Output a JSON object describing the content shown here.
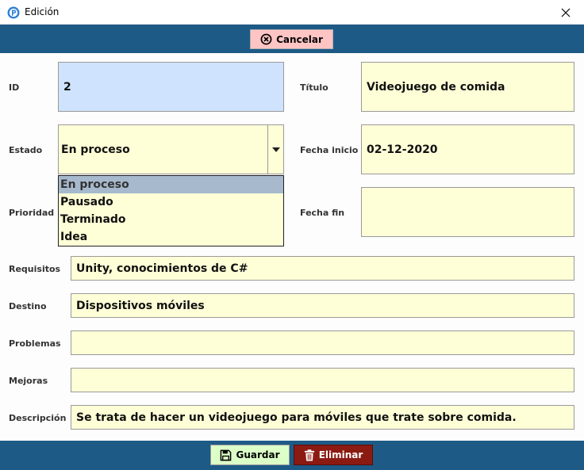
{
  "window": {
    "title": "Edición",
    "app_icon": "p-logo-icon",
    "close_glyph": "✕"
  },
  "toolbar": {
    "cancel_label": "Cancelar",
    "cancel_icon": "circle-x-icon"
  },
  "fields": {
    "id": {
      "label": "ID",
      "value": "2"
    },
    "titulo": {
      "label": "Título",
      "value": "Videojuego de comida"
    },
    "estado": {
      "label": "Estado",
      "value": "En proceso",
      "options": [
        "En proceso",
        "Pausado",
        "Terminado",
        "Idea"
      ],
      "selected_index": 0
    },
    "fecha_inicio": {
      "label": "Fecha inicio",
      "value": "02-12-2020"
    },
    "prioridad": {
      "label": "Prioridad",
      "value": ""
    },
    "fecha_fin": {
      "label": "Fecha fin",
      "value": ""
    },
    "requisitos": {
      "label": "Requisitos",
      "value": "Unity, conocimientos de C#"
    },
    "destino": {
      "label": "Destino",
      "value": "Dispositivos móviles"
    },
    "problemas": {
      "label": "Problemas",
      "value": ""
    },
    "mejoras": {
      "label": "Mejoras",
      "value": ""
    },
    "descripcion": {
      "label": "Descripción",
      "value": "Se trata de hacer un videojuego para móviles que trate sobre comida."
    }
  },
  "footer": {
    "save_label": "Guardar",
    "save_icon": "floppy-disk-icon",
    "delete_label": "Eliminar",
    "delete_icon": "trash-icon"
  },
  "colors": {
    "header_bar": "#1e5a86",
    "field_bg": "#ffffd7",
    "id_field_bg": "#cfe3ff",
    "cancel_bg": "#ffc5c5",
    "save_bg": "#dcffc8",
    "delete_bg": "#8b1a12",
    "dropdown_selected": "#a6b9cd"
  }
}
